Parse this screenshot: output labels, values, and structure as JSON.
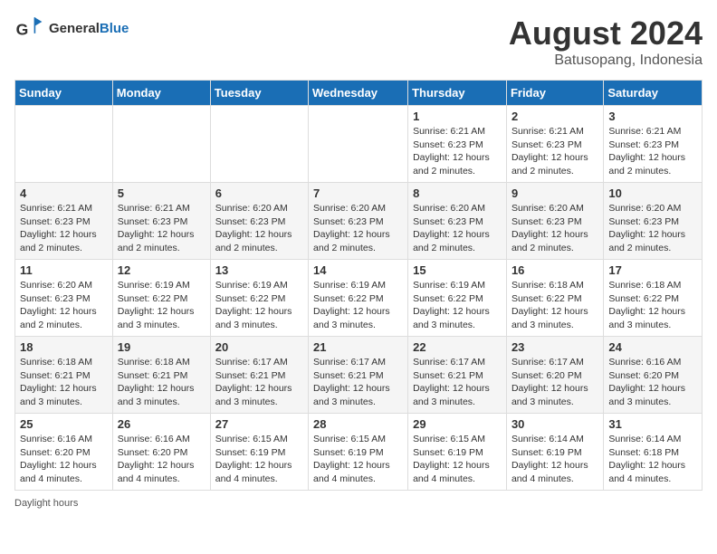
{
  "header": {
    "logo_line1": "General",
    "logo_line2": "Blue",
    "month_year": "August 2024",
    "location": "Batusopang, Indonesia"
  },
  "days_of_week": [
    "Sunday",
    "Monday",
    "Tuesday",
    "Wednesday",
    "Thursday",
    "Friday",
    "Saturday"
  ],
  "weeks": [
    [
      {
        "day": "",
        "info": ""
      },
      {
        "day": "",
        "info": ""
      },
      {
        "day": "",
        "info": ""
      },
      {
        "day": "",
        "info": ""
      },
      {
        "day": "1",
        "info": "Sunrise: 6:21 AM\nSunset: 6:23 PM\nDaylight: 12 hours\nand 2 minutes."
      },
      {
        "day": "2",
        "info": "Sunrise: 6:21 AM\nSunset: 6:23 PM\nDaylight: 12 hours\nand 2 minutes."
      },
      {
        "day": "3",
        "info": "Sunrise: 6:21 AM\nSunset: 6:23 PM\nDaylight: 12 hours\nand 2 minutes."
      }
    ],
    [
      {
        "day": "4",
        "info": "Sunrise: 6:21 AM\nSunset: 6:23 PM\nDaylight: 12 hours\nand 2 minutes."
      },
      {
        "day": "5",
        "info": "Sunrise: 6:21 AM\nSunset: 6:23 PM\nDaylight: 12 hours\nand 2 minutes."
      },
      {
        "day": "6",
        "info": "Sunrise: 6:20 AM\nSunset: 6:23 PM\nDaylight: 12 hours\nand 2 minutes."
      },
      {
        "day": "7",
        "info": "Sunrise: 6:20 AM\nSunset: 6:23 PM\nDaylight: 12 hours\nand 2 minutes."
      },
      {
        "day": "8",
        "info": "Sunrise: 6:20 AM\nSunset: 6:23 PM\nDaylight: 12 hours\nand 2 minutes."
      },
      {
        "day": "9",
        "info": "Sunrise: 6:20 AM\nSunset: 6:23 PM\nDaylight: 12 hours\nand 2 minutes."
      },
      {
        "day": "10",
        "info": "Sunrise: 6:20 AM\nSunset: 6:23 PM\nDaylight: 12 hours\nand 2 minutes."
      }
    ],
    [
      {
        "day": "11",
        "info": "Sunrise: 6:20 AM\nSunset: 6:23 PM\nDaylight: 12 hours\nand 2 minutes."
      },
      {
        "day": "12",
        "info": "Sunrise: 6:19 AM\nSunset: 6:22 PM\nDaylight: 12 hours\nand 3 minutes."
      },
      {
        "day": "13",
        "info": "Sunrise: 6:19 AM\nSunset: 6:22 PM\nDaylight: 12 hours\nand 3 minutes."
      },
      {
        "day": "14",
        "info": "Sunrise: 6:19 AM\nSunset: 6:22 PM\nDaylight: 12 hours\nand 3 minutes."
      },
      {
        "day": "15",
        "info": "Sunrise: 6:19 AM\nSunset: 6:22 PM\nDaylight: 12 hours\nand 3 minutes."
      },
      {
        "day": "16",
        "info": "Sunrise: 6:18 AM\nSunset: 6:22 PM\nDaylight: 12 hours\nand 3 minutes."
      },
      {
        "day": "17",
        "info": "Sunrise: 6:18 AM\nSunset: 6:22 PM\nDaylight: 12 hours\nand 3 minutes."
      }
    ],
    [
      {
        "day": "18",
        "info": "Sunrise: 6:18 AM\nSunset: 6:21 PM\nDaylight: 12 hours\nand 3 minutes."
      },
      {
        "day": "19",
        "info": "Sunrise: 6:18 AM\nSunset: 6:21 PM\nDaylight: 12 hours\nand 3 minutes."
      },
      {
        "day": "20",
        "info": "Sunrise: 6:17 AM\nSunset: 6:21 PM\nDaylight: 12 hours\nand 3 minutes."
      },
      {
        "day": "21",
        "info": "Sunrise: 6:17 AM\nSunset: 6:21 PM\nDaylight: 12 hours\nand 3 minutes."
      },
      {
        "day": "22",
        "info": "Sunrise: 6:17 AM\nSunset: 6:21 PM\nDaylight: 12 hours\nand 3 minutes."
      },
      {
        "day": "23",
        "info": "Sunrise: 6:17 AM\nSunset: 6:20 PM\nDaylight: 12 hours\nand 3 minutes."
      },
      {
        "day": "24",
        "info": "Sunrise: 6:16 AM\nSunset: 6:20 PM\nDaylight: 12 hours\nand 3 minutes."
      }
    ],
    [
      {
        "day": "25",
        "info": "Sunrise: 6:16 AM\nSunset: 6:20 PM\nDaylight: 12 hours\nand 4 minutes."
      },
      {
        "day": "26",
        "info": "Sunrise: 6:16 AM\nSunset: 6:20 PM\nDaylight: 12 hours\nand 4 minutes."
      },
      {
        "day": "27",
        "info": "Sunrise: 6:15 AM\nSunset: 6:19 PM\nDaylight: 12 hours\nand 4 minutes."
      },
      {
        "day": "28",
        "info": "Sunrise: 6:15 AM\nSunset: 6:19 PM\nDaylight: 12 hours\nand 4 minutes."
      },
      {
        "day": "29",
        "info": "Sunrise: 6:15 AM\nSunset: 6:19 PM\nDaylight: 12 hours\nand 4 minutes."
      },
      {
        "day": "30",
        "info": "Sunrise: 6:14 AM\nSunset: 6:19 PM\nDaylight: 12 hours\nand 4 minutes."
      },
      {
        "day": "31",
        "info": "Sunrise: 6:14 AM\nSunset: 6:18 PM\nDaylight: 12 hours\nand 4 minutes."
      }
    ]
  ],
  "footer": {
    "daylight_hours_label": "Daylight hours"
  }
}
